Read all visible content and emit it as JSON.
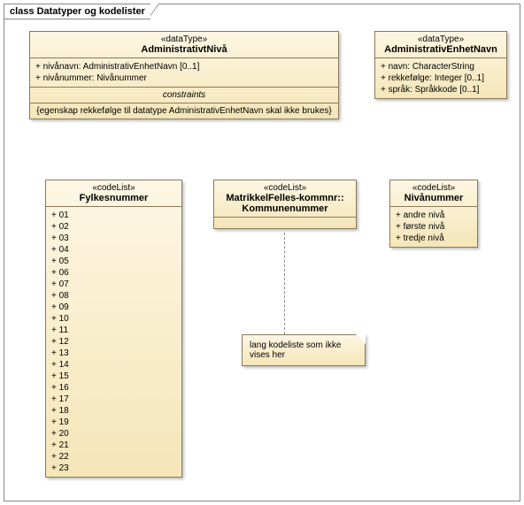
{
  "frame": {
    "title": "class Datatyper og kodelister"
  },
  "adminNivaa": {
    "stereo": "«dataType»",
    "name": "AdministrativtNivå",
    "attrs": [
      "+   nivånavn: AdministrativEnhetNavn [0..1]",
      "+   nivånummer: Nivånummer"
    ],
    "constraintsHdr": "constraints",
    "constraintsBody": "{egenskap rekkefølge til datatype AdministrativEnhetNavn skal ikke brukes}"
  },
  "adminEnhetNavn": {
    "stereo": "«dataType»",
    "name": "AdministrativEnhetNavn",
    "attrs": [
      "+   navn: CharacterString",
      "+   rekkefølge: Integer [0..1]",
      "+   språk: Språkkode [0..1]"
    ]
  },
  "fylkesnummer": {
    "stereo": "«codeList»",
    "name": "Fylkesnummer",
    "attrs": [
      "+   01",
      "+   02",
      "+   03",
      "+   04",
      "+   05",
      "+   06",
      "+   07",
      "+   08",
      "+   09",
      "+   10",
      "+   11",
      "+   12",
      "+   13",
      "+   14",
      "+   15",
      "+   16",
      "+   17",
      "+   18",
      "+   19",
      "+   20",
      "+   21",
      "+   22",
      "+   23"
    ]
  },
  "kommunenummer": {
    "stereo": "«codeList»",
    "name1": "MatrikkelFelles-kommnr::",
    "name2": "Kommunenummer"
  },
  "nivaanummer": {
    "stereo": "«codeList»",
    "name": "Nivånummer",
    "attrs": [
      "+   andre nivå",
      "+   første nivå",
      "+   tredje nivå"
    ]
  },
  "note": {
    "text": "lang kodeliste som ikke vises her"
  }
}
